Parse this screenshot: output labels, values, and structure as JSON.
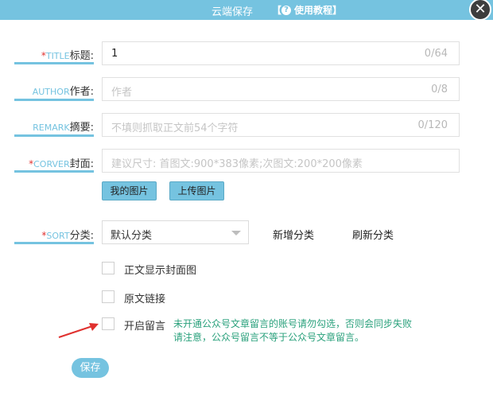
{
  "window": {
    "title": "云端保存",
    "help_bracket_open": "【",
    "help_label": "使用教程",
    "help_bracket_close": "】",
    "help_icon_glyph": "?",
    "close_glyph": "✕"
  },
  "fields": {
    "title": {
      "required": "*",
      "en": "TITLE",
      "cn": "标题:",
      "value": "1",
      "counter": "0/64"
    },
    "author": {
      "en": "AUTHOR",
      "cn": "作者:",
      "placeholder": "作者",
      "counter": "0/8"
    },
    "remark": {
      "en": "REMARK",
      "cn": "摘要:",
      "placeholder": "不填则抓取正文前54个字符",
      "counter": "0/120"
    },
    "cover": {
      "required": "*",
      "en": "CORVER",
      "cn": "封面:",
      "placeholder": "建议尺寸: 首图文:900*383像素;次图文:200*200像素"
    }
  },
  "cover_buttons": {
    "my_images": "我的图片",
    "upload": "上传图片"
  },
  "sort": {
    "required": "*",
    "en": "SORT",
    "cn": "分类:",
    "selected": "默认分类",
    "add": "新增分类",
    "refresh": "刷新分类"
  },
  "options": [
    {
      "label": "正文显示封面图",
      "checked": false
    },
    {
      "label": "原文链接",
      "checked": false
    },
    {
      "label": "开启留言",
      "checked": false
    }
  ],
  "comment_note": {
    "line1": "未开通公众号文章留言的账号请勿勾选，否则会同步失败",
    "line2": "请注意，公众号留言不等于公众号文章留言。"
  },
  "save_label": "保存",
  "colors": {
    "accent": "#75c3e0",
    "required": "#e0312f",
    "note": "#2aa17c",
    "arrow": "#e0312f"
  }
}
